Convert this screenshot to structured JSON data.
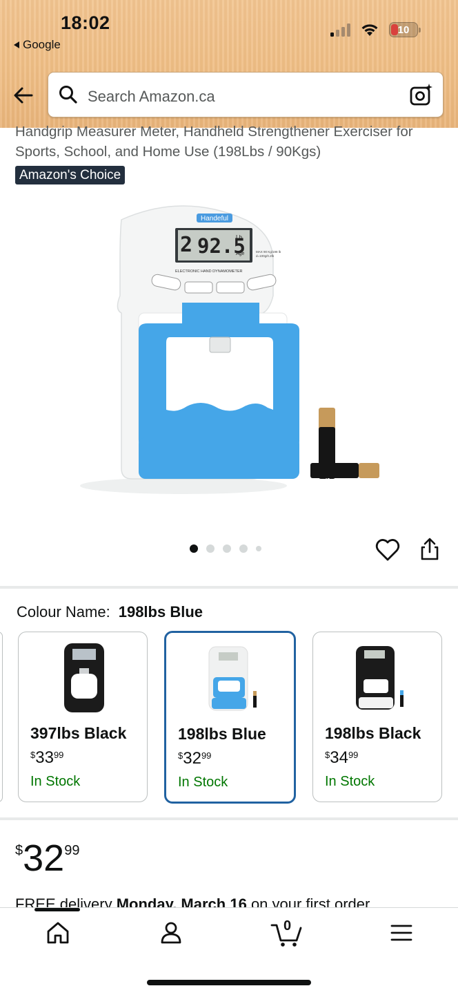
{
  "status_bar": {
    "time": "18:02",
    "back_app": "Google",
    "battery": "10",
    "icons": [
      "signal-icon",
      "wifi-icon",
      "battery-icon"
    ]
  },
  "search": {
    "placeholder": "Search Amazon.ca",
    "icons": [
      "back-arrow-icon",
      "search-icon",
      "camera-lens-icon"
    ]
  },
  "product": {
    "title": "Handgrip Measurer Meter, Handheld Strengthener Exerciser for Sports, School, and Home Use (198Lbs / 90Kgs)",
    "badge": "Amazon's Choice",
    "image_brand": "Handeful",
    "image_count": 5,
    "active_image": 1
  },
  "colour": {
    "label": "Colour Name:",
    "selected": "198lbs Blue",
    "options": [
      {
        "name": "397lbs Black",
        "price_whole": "33",
        "price_frac": "99",
        "currency": "$",
        "stock": "In Stock",
        "selected": false
      },
      {
        "name": "198lbs Blue",
        "price_whole": "32",
        "price_frac": "99",
        "currency": "$",
        "stock": "In Stock",
        "selected": true
      },
      {
        "name": "198lbs Black",
        "price_whole": "34",
        "price_frac": "99",
        "currency": "$",
        "stock": "In Stock",
        "selected": false
      }
    ]
  },
  "price": {
    "currency": "$",
    "whole": "32",
    "frac": "99"
  },
  "delivery": {
    "prefix": "FREE delivery",
    "date": "Monday, March 16",
    "suffix": "on your first order"
  },
  "bottom_nav": {
    "items": [
      "home-icon",
      "account-icon",
      "cart-icon",
      "menu-icon"
    ],
    "cart_count": "0"
  },
  "colors": {
    "accent": "#2162a1",
    "stock": "#007600",
    "badge": "#232f3e",
    "header": "#efbd84"
  }
}
